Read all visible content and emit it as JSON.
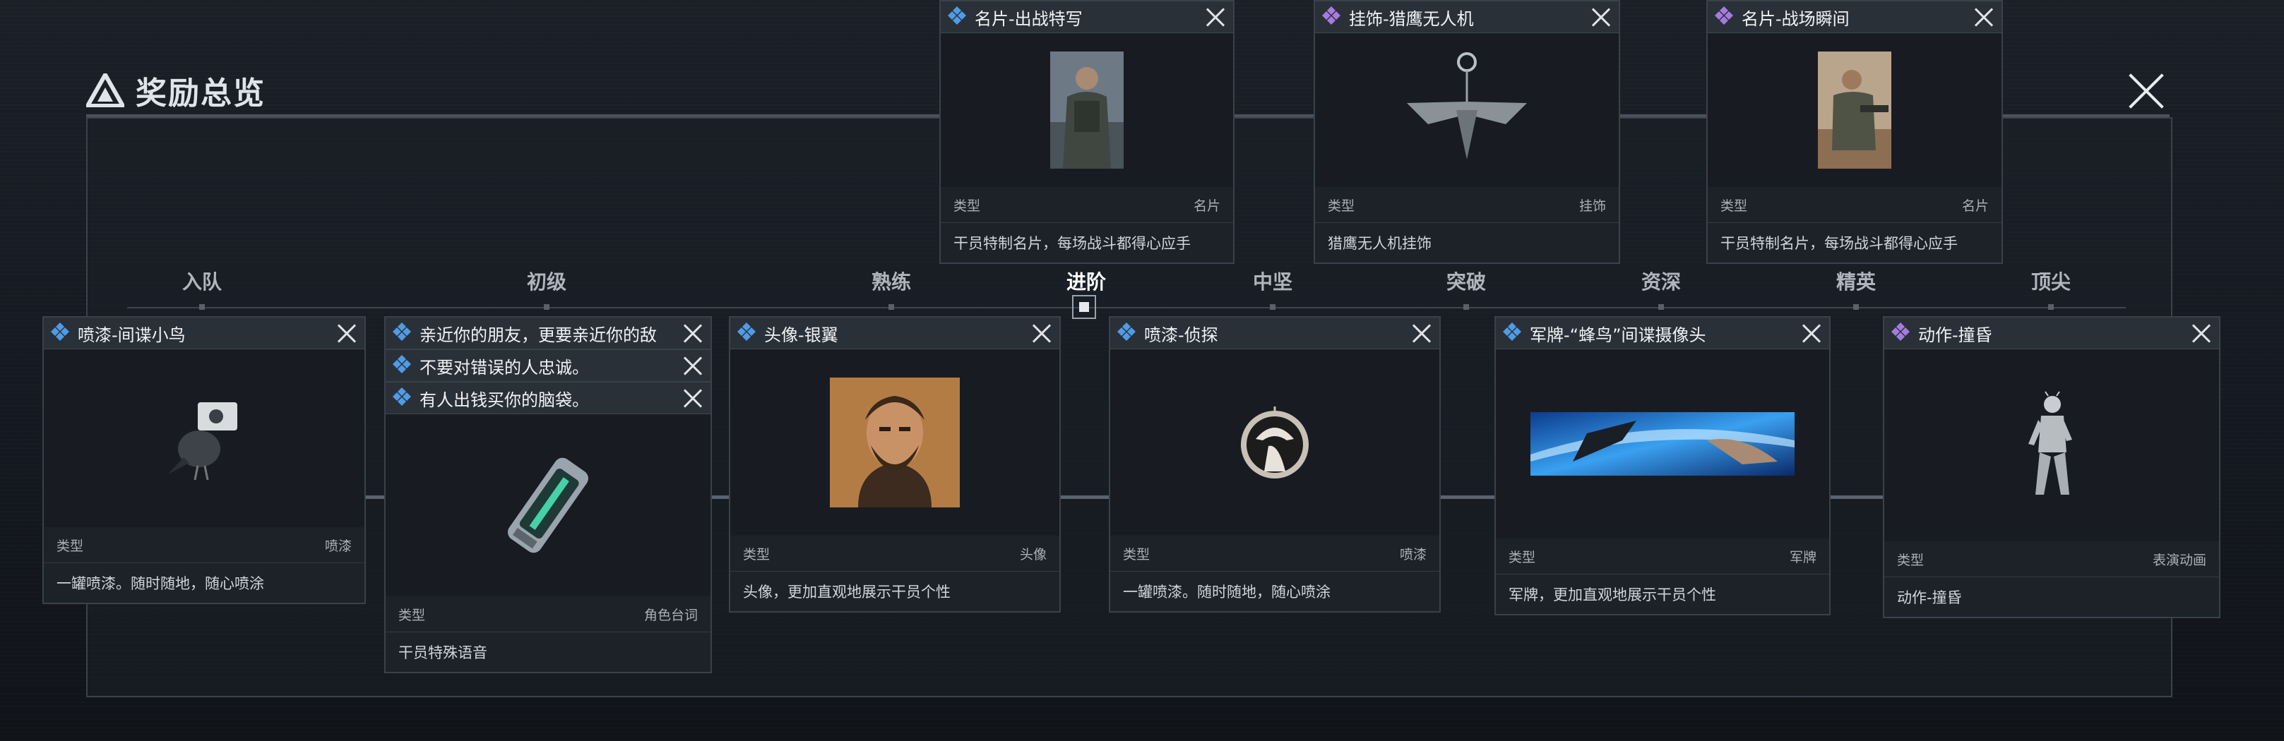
{
  "title": "奖励总览",
  "colors": {
    "rarity_blue": "#4f9be6",
    "rarity_purple": "#a57be0"
  },
  "stages": [
    {
      "label": "入队",
      "active": false
    },
    {
      "label": "初级",
      "active": false
    },
    {
      "label": "熟练",
      "active": false
    },
    {
      "label": "进阶",
      "active": true
    },
    {
      "label": "中坚",
      "active": false
    },
    {
      "label": "突破",
      "active": false
    },
    {
      "label": "资深",
      "active": false
    },
    {
      "label": "精英",
      "active": false
    },
    {
      "label": "顶尖",
      "active": false
    }
  ],
  "top_cards": [
    {
      "name": "名片-出战特写",
      "rarity": "blue",
      "type_label": "类型",
      "type_value": "名片",
      "desc": "干员特制名片，每场战斗都得心应手",
      "icon": "namecard-soldier-portrait"
    },
    {
      "name": "挂饰-猎鹰无人机",
      "rarity": "purple",
      "type_label": "类型",
      "type_value": "挂饰",
      "desc": "猎鹰无人机挂饰",
      "icon": "falcon-drone-charm"
    },
    {
      "name": "名片-战场瞬间",
      "rarity": "purple",
      "type_label": "类型",
      "type_value": "名片",
      "desc": "干员特制名片，每场战斗都得心应手",
      "icon": "namecard-battlefield"
    }
  ],
  "bottom_cards": [
    {
      "name": "喷漆-间谍小鸟",
      "rarity": "blue",
      "type_label": "类型",
      "type_value": "喷漆",
      "desc": "一罐喷漆。随时随地，随心喷涂",
      "icon": "spy-bird-spray"
    },
    {
      "name": "有人出钱买你的脑袋。",
      "rarity": "blue",
      "type_label": "类型",
      "type_value": "角色台词",
      "desc": "干员特殊语音",
      "icon": "voice-device",
      "stack": [
        "亲近你的朋友，更要亲近你的敌",
        "不要对错误的人忠诚。"
      ]
    },
    {
      "name": "头像-银翼",
      "rarity": "blue",
      "type_label": "类型",
      "type_value": "头像",
      "desc": "头像，更加直观地展示干员个性",
      "icon": "avatar-silverwing"
    },
    {
      "name": "喷漆-侦探",
      "rarity": "blue",
      "type_label": "类型",
      "type_value": "喷漆",
      "desc": "一罐喷漆。随时随地，随心喷涂",
      "icon": "detective-spray"
    },
    {
      "name": "军牌-“蜂鸟”间谍摄像头",
      "rarity": "blue",
      "type_label": "类型",
      "type_value": "军牌",
      "desc": "军牌，更加直观地展示干员个性",
      "icon": "hummingbird-banner"
    },
    {
      "name": "动作-撞昏",
      "rarity": "purple",
      "type_label": "类型",
      "type_value": "表演动画",
      "desc": "动作-撞昏",
      "icon": "emote-figure"
    }
  ]
}
